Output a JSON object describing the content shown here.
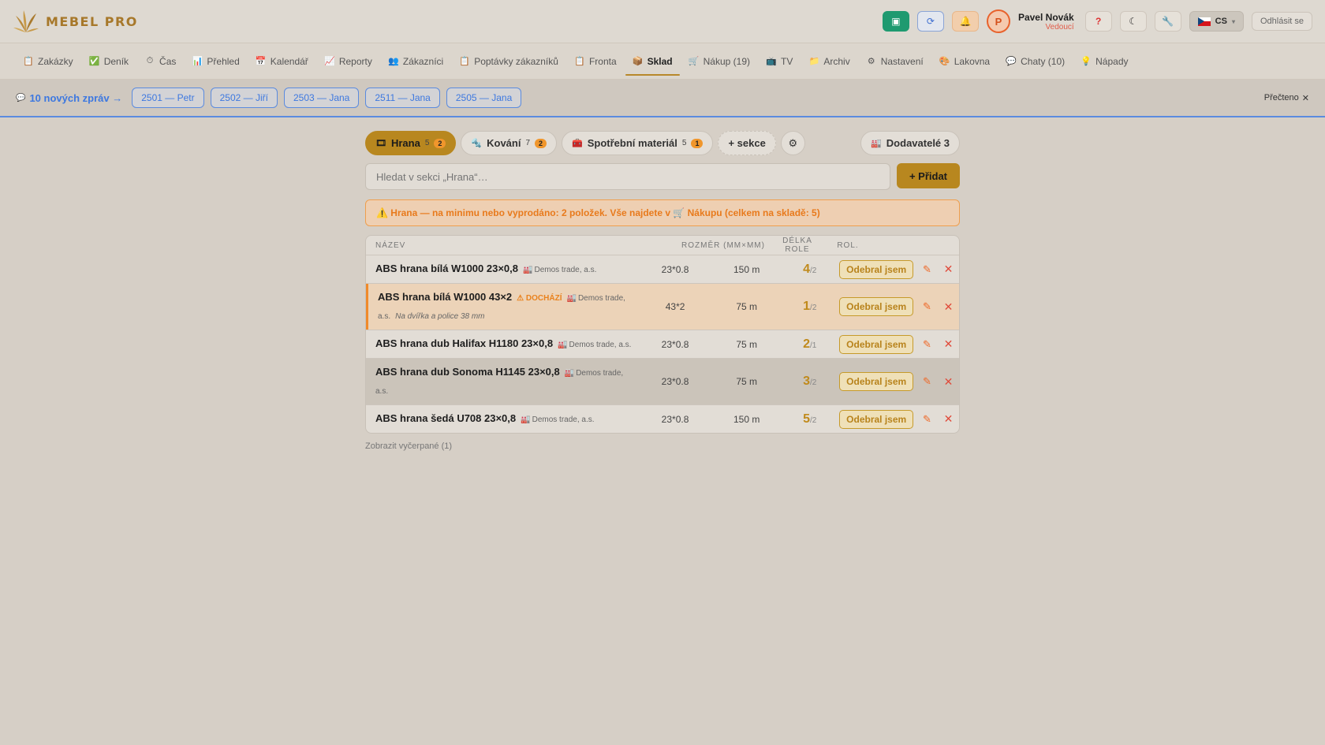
{
  "brand": {
    "name": "MEBEL PRO",
    "icon": "leaf-logo-icon"
  },
  "user": {
    "initial": "P",
    "name": "Pavel Novák",
    "role": "Vedoucí"
  },
  "header": {
    "help": "?",
    "language": "CS",
    "logout": "Odhlásit se"
  },
  "nav": [
    {
      "icon": "📋",
      "label": "Zakázky"
    },
    {
      "icon": "✅",
      "label": "Deník"
    },
    {
      "icon": "⏱",
      "label": "Čas"
    },
    {
      "icon": "📊",
      "label": "Přehled"
    },
    {
      "icon": "📅",
      "label": "Kalendář"
    },
    {
      "icon": "📈",
      "label": "Reporty"
    },
    {
      "icon": "👥",
      "label": "Zákazníci"
    },
    {
      "icon": "📋",
      "label": "Poptávky zákazníků"
    },
    {
      "icon": "📋",
      "label": "Fronta"
    },
    {
      "icon": "📦",
      "label": "Sklad"
    },
    {
      "icon": "🛒",
      "label": "Nákup (19)"
    },
    {
      "icon": "📺",
      "label": "TV"
    },
    {
      "icon": "📁",
      "label": "Archiv"
    },
    {
      "icon": "⚙",
      "label": "Nastavení"
    },
    {
      "icon": "🎨",
      "label": "Lakovna"
    },
    {
      "icon": "💬",
      "label": "Chaty (10)"
    },
    {
      "icon": "💡",
      "label": "Nápady"
    }
  ],
  "messages": {
    "link": "10 nových zpráv →",
    "chips": [
      "2501 — Petr",
      "2502 — Jiří",
      "2503 — Jana",
      "2511 — Jana",
      "2505 — Jana"
    ],
    "read": "Přečteno"
  },
  "tabs": [
    {
      "icon": "🎞",
      "label": "Hrana",
      "count": "5",
      "badge": "2"
    },
    {
      "icon": "🔩",
      "label": "Kování",
      "count": "7",
      "badge": "2"
    },
    {
      "icon": "🧰",
      "label": "Spotřební materiál",
      "count": "5",
      "badge": "1"
    }
  ],
  "add_section": "+ sekce",
  "suppliers": {
    "label": "Dodavatelé 3"
  },
  "search": {
    "placeholder": "Hledat v sekci „Hrana“…"
  },
  "add_button": "+ Přidat",
  "warning": "⚠️ Hrana — na minimu nebo vyprodáno: 2 položek. Vše najdete v 🛒 Nákupu (celkem na skladě: 5)",
  "table": {
    "headers": {
      "name": "NÁZEV",
      "size": "ROZMĚR (MM×MM)",
      "length": "DÉLKA ROLE",
      "rolls": "ROL."
    },
    "take_label": "Odebral jsem",
    "rows": [
      {
        "name": "ABS hrana bílá W1000 23×0,8",
        "supplier": "Demos trade, a.s.",
        "status": "",
        "note": "",
        "size": "23*0.8",
        "length": "150 m",
        "rolls": "4",
        "min": "/2"
      },
      {
        "name": "ABS hrana bílá W1000 43×2",
        "supplier": "Demos trade, a.s.",
        "status": "DOCHÁZÍ",
        "note": "Na dvířka a police 38 mm",
        "size": "43*2",
        "length": "75 m",
        "rolls": "1",
        "min": "/2"
      },
      {
        "name": "ABS hrana dub Halifax H1180 23×0,8",
        "supplier": "Demos trade, a.s.",
        "status": "",
        "note": "",
        "size": "23*0.8",
        "length": "75 m",
        "rolls": "2",
        "min": "/1"
      },
      {
        "name": "ABS hrana dub Sonoma H1145 23×0,8",
        "supplier": "Demos trade, a.s.",
        "status": "",
        "note": "",
        "size": "23*0.8",
        "length": "75 m",
        "rolls": "3",
        "min": "/2"
      },
      {
        "name": "ABS hrana šedá U708 23×0,8",
        "supplier": "Demos trade, a.s.",
        "status": "",
        "note": "",
        "size": "23*0.8",
        "length": "150 m",
        "rolls": "5",
        "min": "/2"
      }
    ]
  },
  "show_used": "Zobrazit vyčerpané (1)"
}
